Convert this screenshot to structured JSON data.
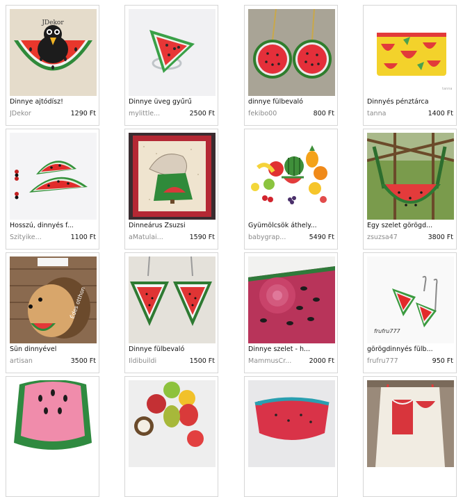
{
  "products": [
    {
      "title": "Dinnye ajtódísz!",
      "seller": "JDekor",
      "price": "1290 Ft",
      "image": "watermelon-crow-door-decor",
      "watermark": "JDekor"
    },
    {
      "title": "Dinnye üveg gyűrű",
      "seller": "mylittle...",
      "price": "2500 Ft",
      "image": "glass-watermelon-ring"
    },
    {
      "title": "dinnye fülbevaló",
      "seller": "fekibo00",
      "price": "800 Ft",
      "image": "round-watermelon-earrings"
    },
    {
      "title": "Dinnyés pénztárca",
      "seller": "tanna",
      "price": "1400 Ft",
      "image": "watermelon-print-purse"
    },
    {
      "title": "Hosszú, dinnyés f...",
      "seller": "Szityike...",
      "price": "1100 Ft",
      "image": "watermelon-slice-earrings"
    },
    {
      "title": "Dinneárus Zsuzsi",
      "seller": "aMatulai...",
      "price": "1590 Ft",
      "image": "sunbonnet-quilt"
    },
    {
      "title": "Gyümölcsök áthely...",
      "seller": "babygrap...",
      "price": "5490 Ft",
      "image": "fruit-stickers"
    },
    {
      "title": "Egy szelet görögd...",
      "seller": "zsuzsa47",
      "price": "3800 Ft",
      "image": "watermelon-bag"
    },
    {
      "title": "Sün dinnyével",
      "seller": "artisan",
      "price": "3500 Ft",
      "image": "hedgehog-with-watermelon"
    },
    {
      "title": "Dinnye fülbevaló",
      "seller": "Ildibuildi",
      "price": "1500 Ft",
      "image": "beaded-triangle-earrings"
    },
    {
      "title": "Dinnye szelet - h...",
      "seller": "MammusCr...",
      "price": "2000 Ft",
      "image": "crochet-watermelon"
    },
    {
      "title": "görögdinnyés fülb...",
      "seller": "frufru777",
      "price": "950 Ft",
      "image": "watermelon-drop-earrings",
      "watermark": "frufru777"
    },
    {
      "title": "",
      "seller": "",
      "price": "",
      "image": "watermelon-beanbag"
    },
    {
      "title": "",
      "seller": "",
      "price": "",
      "image": "crochet-fruits"
    },
    {
      "title": "",
      "seller": "",
      "price": "",
      "image": "watermelon-hip-bag"
    },
    {
      "title": "",
      "seller": "",
      "price": "",
      "image": "watermelon-apron"
    }
  ]
}
